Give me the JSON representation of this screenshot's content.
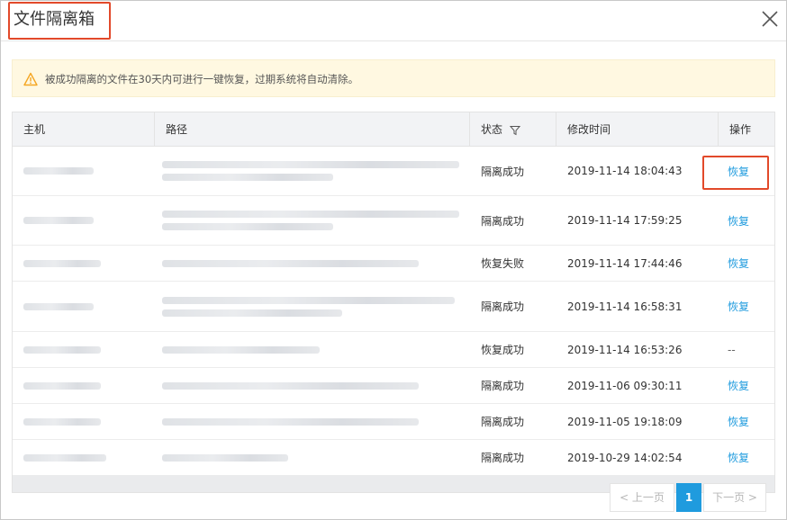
{
  "dialog": {
    "title": "文件隔离箱",
    "close_icon": "close-icon"
  },
  "notice": {
    "icon": "warning-icon",
    "text": "被成功隔离的文件在30天内可进行一键恢复，过期系统将自动清除。"
  },
  "table": {
    "headers": {
      "host": "主机",
      "path": "路径",
      "status": "状态",
      "modified": "修改时间",
      "action": "操作"
    },
    "rows": [
      {
        "status": "隔离成功",
        "modified": "2019-11-14 18:04:43",
        "action": "恢复"
      },
      {
        "status": "隔离成功",
        "modified": "2019-11-14 17:59:25",
        "action": "恢复"
      },
      {
        "status": "恢复失败",
        "modified": "2019-11-14 17:44:46",
        "action": "恢复"
      },
      {
        "status": "隔离成功",
        "modified": "2019-11-14 16:58:31",
        "action": "恢复"
      },
      {
        "status": "恢复成功",
        "modified": "2019-11-14 16:53:26",
        "action": "--"
      },
      {
        "status": "隔离成功",
        "modified": "2019-11-06 09:30:11",
        "action": "恢复"
      },
      {
        "status": "隔离成功",
        "modified": "2019-11-05 19:18:09",
        "action": "恢复"
      },
      {
        "status": "隔离成功",
        "modified": "2019-10-29 14:02:54",
        "action": "恢复"
      }
    ]
  },
  "pagination": {
    "prev": "< 上一页",
    "current": "1",
    "next": "下一页 >"
  },
  "colors": {
    "link": "#1f9bde",
    "highlight": "#e2492a",
    "notice_bg": "#fff8e1"
  }
}
